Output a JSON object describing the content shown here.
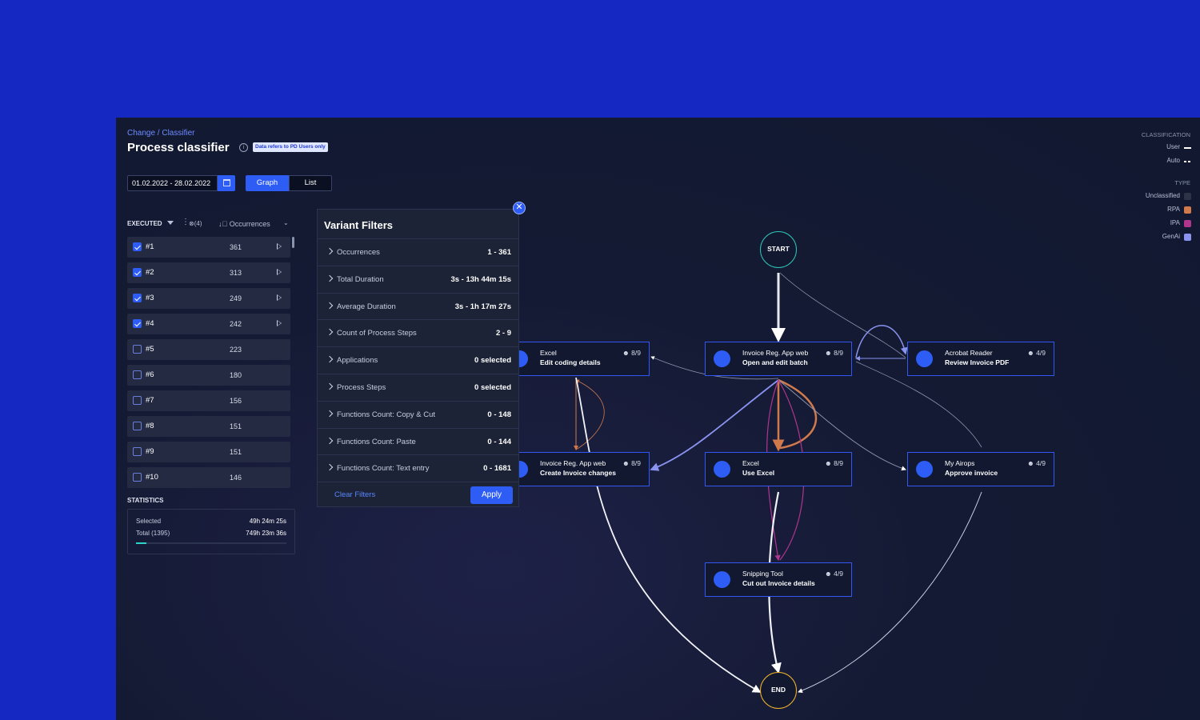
{
  "breadcrumb": "Change / Classifier",
  "page_title": "Process classifier",
  "info_glyph": "i",
  "data_badge": "Data refers to PD Users only",
  "date_range": "01.02.2022 - 28.02.2022",
  "view_toggle": {
    "graph": "Graph",
    "list": "List"
  },
  "executed": {
    "header": "EXECUTED",
    "more_glyph": "⋮",
    "clear_count": "⊗(4)",
    "sort_label": "↓⃥ Occurrences",
    "sort_chevron": "⌄",
    "rows": [
      {
        "label": "#1",
        "count": "361",
        "checked": true
      },
      {
        "label": "#2",
        "count": "313",
        "checked": true
      },
      {
        "label": "#3",
        "count": "249",
        "checked": true
      },
      {
        "label": "#4",
        "count": "242",
        "checked": true
      },
      {
        "label": "#5",
        "count": "223",
        "checked": false
      },
      {
        "label": "#6",
        "count": "180",
        "checked": false
      },
      {
        "label": "#7",
        "count": "156",
        "checked": false
      },
      {
        "label": "#8",
        "count": "151",
        "checked": false
      },
      {
        "label": "#9",
        "count": "151",
        "checked": false
      },
      {
        "label": "#10",
        "count": "146",
        "checked": false
      }
    ]
  },
  "statistics": {
    "title": "STATISTICS",
    "selected_label": "Selected",
    "selected_value": "49h 24m 25s",
    "total_label": "Total (1395)",
    "total_value": "749h 23m 36s",
    "selected_fraction": 0.07
  },
  "variant_filters": {
    "title": "Variant Filters",
    "close_glyph": "✕",
    "rows": [
      {
        "label": "Occurrences",
        "value": "1 - 361"
      },
      {
        "label": "Total Duration",
        "value": "3s - 13h 44m 15s"
      },
      {
        "label": "Average Duration",
        "value": "3s - 1h 17m 27s"
      },
      {
        "label": "Count of Process Steps",
        "value": "2 - 9"
      },
      {
        "label": "Applications",
        "value": "0 selected"
      },
      {
        "label": "Process Steps",
        "value": "0 selected"
      },
      {
        "label": "Functions Count: Copy & Cut",
        "value": "0 - 148"
      },
      {
        "label": "Functions Count: Paste",
        "value": "0 - 144"
      },
      {
        "label": "Functions Count: Text entry",
        "value": "0 - 1681"
      }
    ],
    "clear": "Clear Filters",
    "apply": "Apply"
  },
  "legend": {
    "classification_title": "CLASSIFICATION",
    "user": "User",
    "auto": "Auto",
    "type_title": "TYPE",
    "types": [
      {
        "label": "Unclassified",
        "color": "#2e3447"
      },
      {
        "label": "RPA",
        "color": "#d07a4c"
      },
      {
        "label": "IPA",
        "color": "#b0358f"
      },
      {
        "label": "GenAi",
        "color": "#8a94f0"
      }
    ]
  },
  "graph": {
    "start": "START",
    "end": "END",
    "nodes": [
      {
        "id": "excel-coding",
        "app": "Excel",
        "step": "Edit coding details",
        "users": "8/9"
      },
      {
        "id": "invoice-batch",
        "app": "Invoice Reg. App web",
        "step": "Open and edit batch",
        "users": "8/9"
      },
      {
        "id": "acrobat",
        "app": "Acrobat Reader",
        "step": "Review Invoice PDF",
        "users": "4/9"
      },
      {
        "id": "invoice-create",
        "app": "Invoice Reg. App web",
        "step": "Create Invoice changes",
        "users": "8/9"
      },
      {
        "id": "excel-use",
        "app": "Excel",
        "step": "Use Excel",
        "users": "8/9"
      },
      {
        "id": "airops",
        "app": "My Airops",
        "step": "Approve invoice",
        "users": "4/9"
      },
      {
        "id": "snipping",
        "app": "Snipping Tool",
        "step": "Cut out Invoice details",
        "users": "4/9"
      }
    ]
  }
}
